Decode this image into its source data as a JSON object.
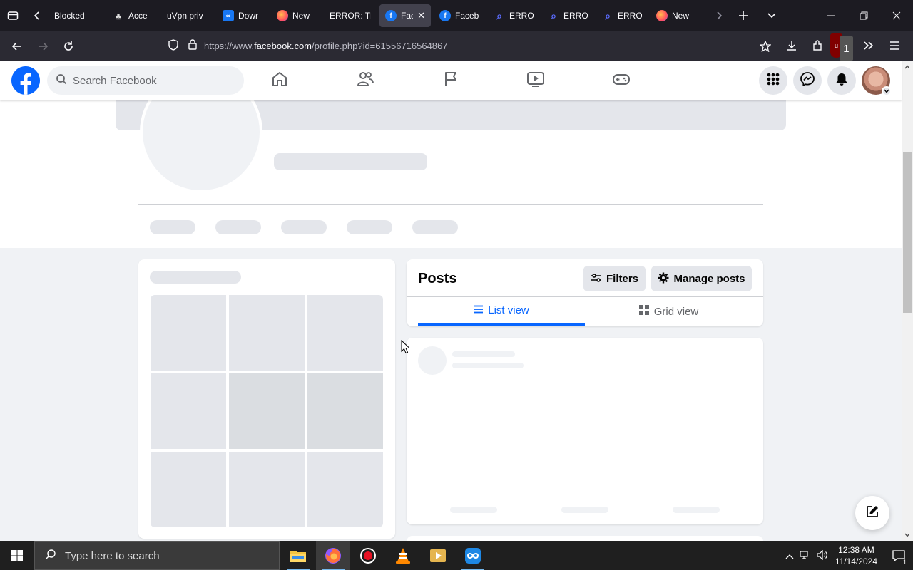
{
  "browser": {
    "tabs": [
      {
        "title": "Blocked",
        "favicon": "blocked-icon",
        "active": false
      },
      {
        "title": "Acce",
        "favicon": "cat-icon",
        "active": false
      },
      {
        "title": "uVpn priv",
        "favicon": "none",
        "active": false
      },
      {
        "title": "Dowr",
        "favicon": "infinity-icon",
        "active": false
      },
      {
        "title": "New",
        "favicon": "firefox-icon",
        "active": false
      },
      {
        "title": "ERROR: Th",
        "favicon": "none",
        "active": false
      },
      {
        "title": "Fac",
        "favicon": "facebook-icon",
        "active": true
      },
      {
        "title": "Faceb",
        "favicon": "facebook-icon",
        "active": false
      },
      {
        "title": "ERRO",
        "favicon": "search-icon",
        "active": false
      },
      {
        "title": "ERRO",
        "favicon": "search-icon",
        "active": false
      },
      {
        "title": "ERRO",
        "favicon": "search-icon",
        "active": false
      },
      {
        "title": "New",
        "favicon": "firefox-icon",
        "active": false
      }
    ],
    "url_prefix": "https://www.",
    "url_host": "facebook.com",
    "url_path": "/profile.php?id=61556716564867",
    "extension_badge": "1"
  },
  "facebook": {
    "search_placeholder": "Search Facebook",
    "posts": {
      "title": "Posts",
      "filters_label": "Filters",
      "manage_label": "Manage posts",
      "list_view_label": "List view",
      "grid_view_label": "Grid view"
    }
  },
  "colors": {
    "fb_blue": "#0866ff",
    "skeleton": "#e4e6eb"
  },
  "taskbar": {
    "search_placeholder": "Type here to search",
    "time": "12:38 AM",
    "date": "11/14/2024",
    "notification_count": "1"
  }
}
